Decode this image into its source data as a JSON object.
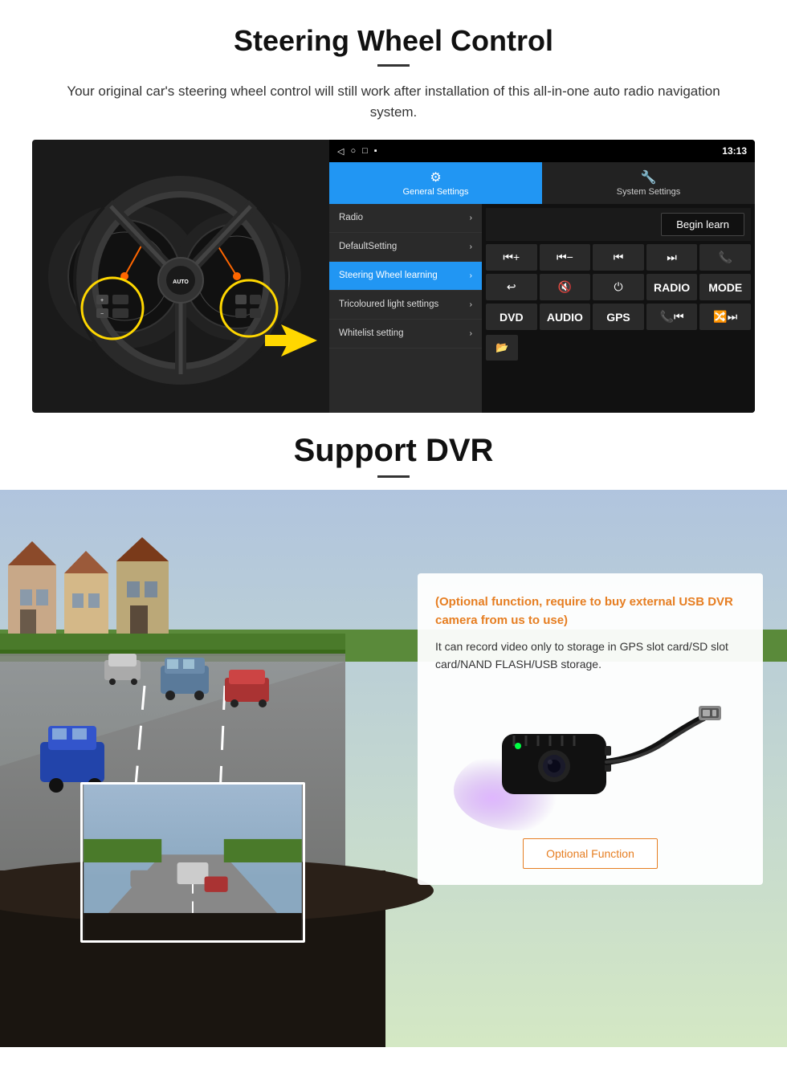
{
  "steering": {
    "title": "Steering Wheel Control",
    "subtitle": "Your original car's steering wheel control will still work after installation of this all-in-one auto radio navigation system.",
    "statusbar": {
      "time": "13:13",
      "icons": [
        "◁",
        "○",
        "□",
        "▪"
      ]
    },
    "tabs": [
      {
        "icon": "⚙",
        "label": "General Settings",
        "active": true
      },
      {
        "icon": "🔧",
        "label": "System Settings",
        "active": false
      }
    ],
    "menu_items": [
      {
        "label": "Radio",
        "active": false
      },
      {
        "label": "DefaultSetting",
        "active": false
      },
      {
        "label": "Steering Wheel learning",
        "active": true
      },
      {
        "label": "Tricoloured light settings",
        "active": false
      },
      {
        "label": "Whitelist setting",
        "active": false
      }
    ],
    "begin_learn_label": "Begin learn",
    "control_buttons_row1": [
      "⏮+",
      "⏮−",
      "⏮",
      "⏭",
      "📞"
    ],
    "control_buttons_row2": [
      "↩",
      "🔇",
      "⏻",
      "RADIO",
      "MODE"
    ],
    "control_buttons_row3": [
      "DVD",
      "AUDIO",
      "GPS",
      "📞⏮",
      "🔀⏭"
    ],
    "control_buttons_row4": [
      "📁"
    ]
  },
  "dvr": {
    "title": "Support DVR",
    "card": {
      "optional_text": "(Optional function, require to buy external USB DVR camera from us to use)",
      "desc_text": "It can record video only to storage in GPS slot card/SD slot card/NAND FLASH/USB storage.",
      "optional_fn_label": "Optional Function"
    }
  }
}
